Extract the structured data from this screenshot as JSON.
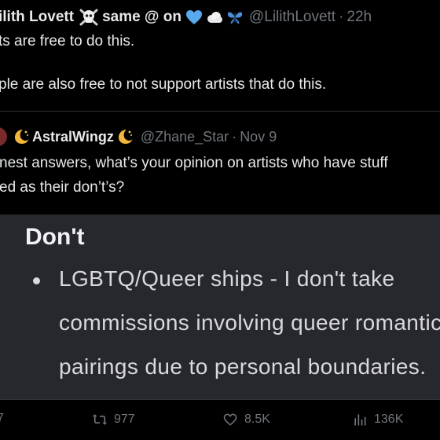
{
  "tweet": {
    "display_name": "ilith Lovett",
    "name_tail": "same @ on",
    "handle": "@LilithLovett",
    "dot": "·",
    "time": "22h",
    "line1": "ts are free to do this.",
    "line2": "ple are also free to not support artists that do this."
  },
  "quote": {
    "name": "AstralWingz",
    "handle": "@Zhane_Star",
    "dot": "·",
    "date": "Nov 9",
    "line1": "nest answers, what’s your opinion on artists who have stuff",
    "line2": "ed as their don’t’s?",
    "image": {
      "heading": "Don't",
      "line1": "LGBTQ/Queer ships - I don't take",
      "line2": "commissions involving queer romantic",
      "line3": "pairings due to personal boundaries."
    }
  },
  "actions": {
    "replies": "7",
    "retweets": "977",
    "likes": "8.5K",
    "views": "136K"
  },
  "icons": {
    "skull": "skull-crossbones-icon",
    "heart": "blue-heart-icon",
    "cloud": "cloud-icon",
    "butterfly": "butterfly-icon",
    "moon": "moon-icon",
    "retweet": "retweet-icon",
    "like": "heart-outline-icon",
    "views": "bar-chart-icon"
  },
  "colors": {
    "background": "#000000",
    "text": "#e7e9ea",
    "muted": "#71767b",
    "border": "#2f3336",
    "image_bg": "#27272e",
    "heart": "#59a9ee"
  }
}
